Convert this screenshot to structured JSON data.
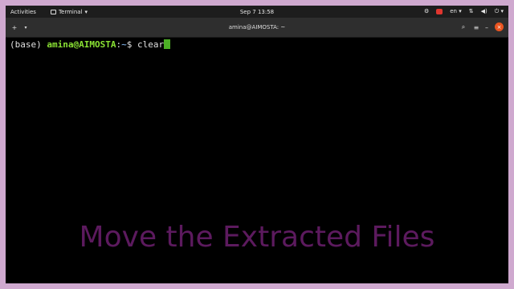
{
  "topbar": {
    "activities": "Activities",
    "app_name": "Terminal",
    "clock": "Sep 7  13:58",
    "lang": "en"
  },
  "window": {
    "title": "amina@AIMOSTA: ~"
  },
  "terminal": {
    "env": "(base) ",
    "user_host": "amina@AIMOSTA",
    "colon": ":",
    "path": "~",
    "symbol": "$ ",
    "command": "clear"
  },
  "caption": "Move the Extracted Files",
  "colors": {
    "border": "#cfa9cf",
    "caption": "#5c1a5e",
    "prompt_user": "#8ae234",
    "prompt_path": "#729fcf",
    "cursor": "#4caf25",
    "close_button": "#e95420"
  }
}
